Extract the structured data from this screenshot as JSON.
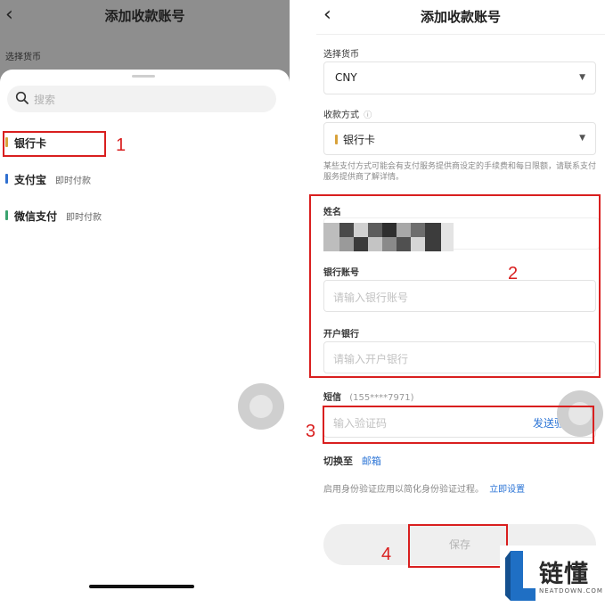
{
  "left": {
    "header": {
      "back_glyph": "‹",
      "title": "添加收款账号"
    },
    "currency_label": "选择货币",
    "search": {
      "placeholder": "搜索"
    },
    "options": [
      {
        "name": "银行卡",
        "tag": "",
        "bar_color": "#d8a23a"
      },
      {
        "name": "支付宝",
        "tag": "即时付款",
        "bar_color": "#2f6fd0"
      },
      {
        "name": "微信支付",
        "tag": "即时付款",
        "bar_color": "#3aa36f"
      }
    ]
  },
  "right": {
    "header": {
      "back_glyph": "‹",
      "title": "添加收款账号"
    },
    "currency": {
      "label": "选择货币",
      "value": "CNY",
      "chevron": "▼"
    },
    "method": {
      "label": "收款方式",
      "info_glyph": "ⓘ",
      "value": "银行卡",
      "chevron": "▼"
    },
    "method_note": "某些支付方式可能会有支付服务提供商设定的手续费和每日限额，请联系支付服务提供商了解详情。",
    "name": {
      "label": "姓名"
    },
    "account": {
      "label": "银行账号",
      "placeholder": "请输入银行账号"
    },
    "bank": {
      "label": "开户银行",
      "placeholder": "请输入开户银行"
    },
    "sms": {
      "label": "短信",
      "phone": "(155****7971)",
      "placeholder": "输入验证码",
      "send": "发送验证码"
    },
    "switch": {
      "prefix": "切换至",
      "link": "邮箱"
    },
    "auth": {
      "text": "启用身份验证应用以简化身份验证过程。",
      "link": "立即设置"
    },
    "save": "保存"
  },
  "annotations": [
    "1",
    "2",
    "3",
    "4"
  ],
  "watermark": {
    "brand": "链懂",
    "domain": "NEATDOWN.COM"
  },
  "colors": {
    "accent_link": "#2b74d6",
    "annotation_red": "#d91f1f",
    "overlay_gray": "#8e8e8e"
  }
}
